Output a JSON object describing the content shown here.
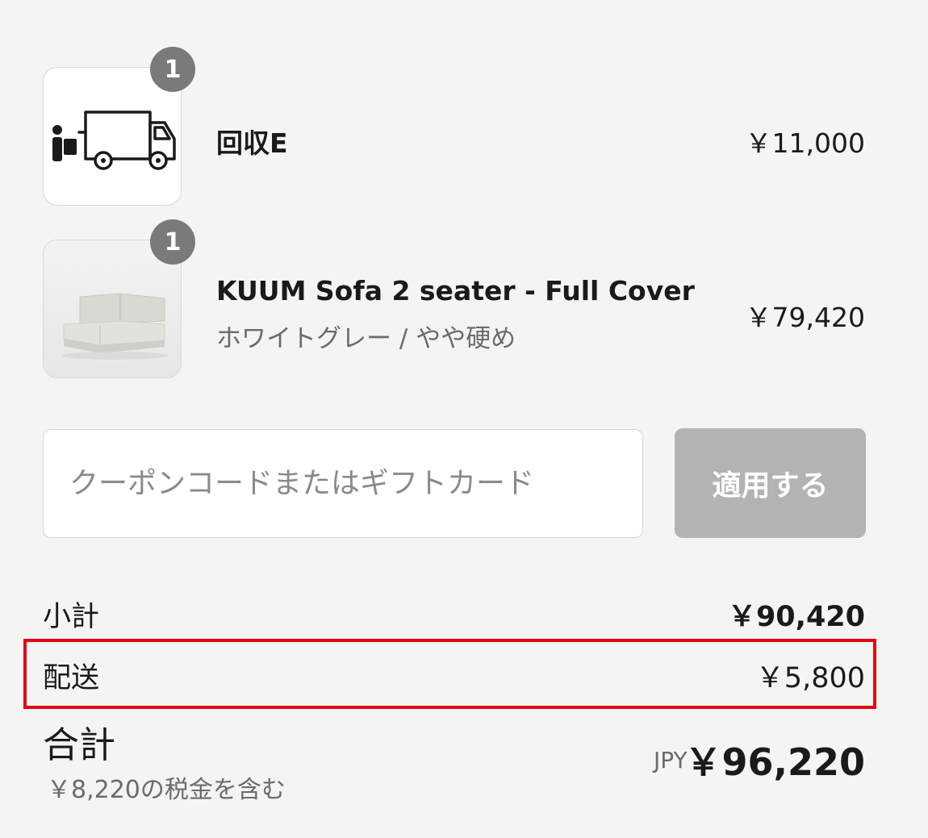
{
  "items": [
    {
      "quantity": "1",
      "title": "回収E",
      "variant": "",
      "price": "￥11,000",
      "thumbnail_icon": "truck-with-person-icon"
    },
    {
      "quantity": "1",
      "title": "KUUM Sofa 2 seater - Full Cover",
      "variant": "ホワイトグレー / やや硬め",
      "price": "￥79,420",
      "thumbnail_icon": "sofa-image"
    }
  ],
  "coupon": {
    "placeholder": "クーポンコードまたはギフトカード",
    "value": "",
    "apply_label": "適用する"
  },
  "summary": {
    "subtotal_label": "小計",
    "subtotal_value": "￥90,420",
    "shipping_label": "配送",
    "shipping_value": "￥5,800",
    "total_label": "合計",
    "tax_note": "￥8,220の税金を含む",
    "currency_code": "JPY",
    "total_value": "￥96,220"
  },
  "colors": {
    "background": "#f4f4f4",
    "badge": "#7a7a7a",
    "apply_button_disabled": "#b3b3b3",
    "highlight": "#e30613"
  }
}
